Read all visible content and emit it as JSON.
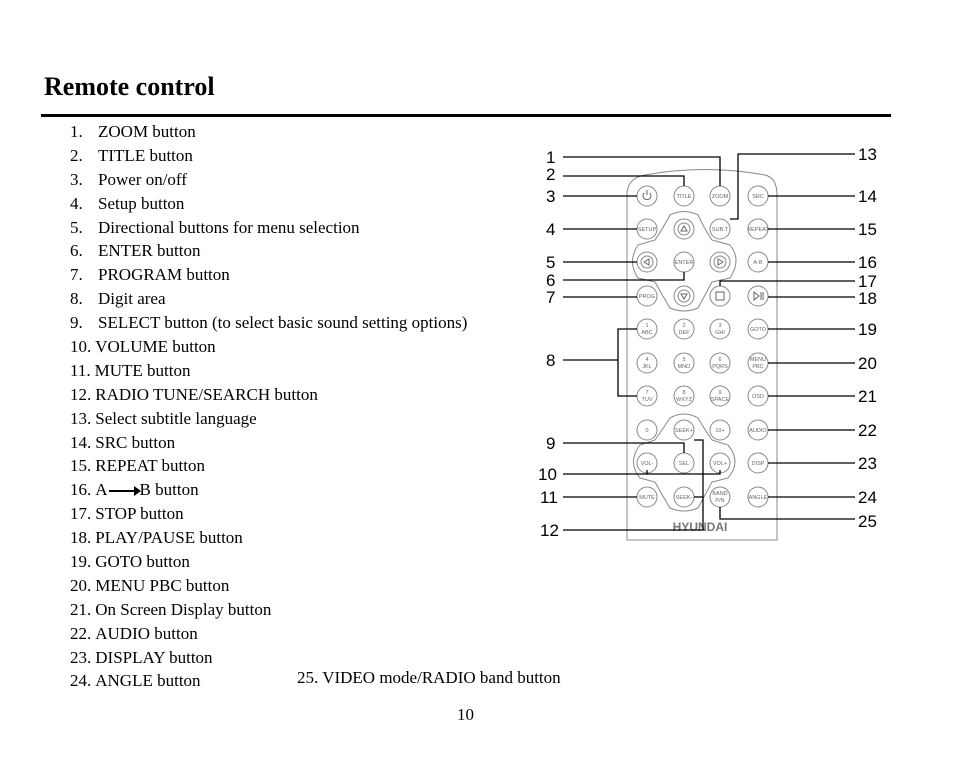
{
  "page": {
    "title": "Remote control",
    "page_number": "10"
  },
  "items": [
    {
      "num": "1.",
      "text": "ZOOM button"
    },
    {
      "num": "2.",
      "text": "TITLE button"
    },
    {
      "num": "3.",
      "text": "Power on/off"
    },
    {
      "num": "4.",
      "text": "Setup button"
    },
    {
      "num": "5.",
      "text": "Directional buttons for menu selection"
    },
    {
      "num": "6.",
      "text": "ENTER button"
    },
    {
      "num": "7.",
      "text": "PROGRAM button"
    },
    {
      "num": "8.",
      "text": "Digit area"
    },
    {
      "num": "9.",
      "text": "SELECT button (to select basic sound setting options)"
    },
    {
      "num": "10.",
      "text": "VOLUME button"
    },
    {
      "num": "11.",
      "text": "MUTE button"
    },
    {
      "num": "12.",
      "text": "RADIO TUNE/SEARCH button"
    },
    {
      "num": "13.",
      "text": "Select subtitle language"
    },
    {
      "num": "14.",
      "text": "SRC button"
    },
    {
      "num": "15.",
      "text": "REPEAT button"
    },
    {
      "num": "16.",
      "text_a": "A",
      "text_b": "B button"
    },
    {
      "num": "17.",
      "text": "STOP button"
    },
    {
      "num": "18.",
      "text": "PLAY/PAUSE button"
    },
    {
      "num": "19.",
      "text": "GOTO button"
    },
    {
      "num": "20.",
      "text": "MENU PBC button"
    },
    {
      "num": "21.",
      "text": "On Screen Display button"
    },
    {
      "num": "22.",
      "text": "AUDIO button"
    },
    {
      "num": "23.",
      "text": "DISPLAY button"
    },
    {
      "num": "24.",
      "text": "ANGLE button"
    },
    {
      "num": "25.",
      "text": "VIDEO mode/RADIO band button"
    }
  ],
  "remote": {
    "brand": "HYUNDAI",
    "callouts_left": [
      "1",
      "2",
      "3",
      "4",
      "5",
      "6",
      "7",
      "8",
      "9",
      "10",
      "11",
      "12"
    ],
    "callouts_right": [
      "13",
      "14",
      "15",
      "16",
      "17",
      "18",
      "19",
      "20",
      "21",
      "22",
      "23",
      "24",
      "25"
    ],
    "buttons": {
      "title": "TITLE",
      "zoom": "ZOOM",
      "src": "SRC",
      "setup": "SETUP",
      "subt": "SUB.T",
      "repeat": "REPEAT",
      "enter": "ENTER",
      "ab": "A-B",
      "prog": "PROG",
      "goto": "GOTO",
      "menu1": "MENU",
      "menu2": "PBC",
      "osd": "OSD",
      "audio": "AUDIO",
      "ten": "10+",
      "sel": "SEL",
      "volm": "VOL-",
      "volp": "VOL+",
      "disp": "DISP",
      "mute": "MUTE",
      "angle": "ANGLE",
      "band1": "BAND",
      "band2": "P/N",
      "seekp": "SEEK+",
      "seekm": "SEEK-",
      "d1a": "1",
      "d1b": "ABC",
      "d2a": "2",
      "d2b": "DEF",
      "d3a": "3",
      "d3b": "GHI",
      "d4a": "4",
      "d4b": "JKL",
      "d5a": "5",
      "d5b": "MNO",
      "d6a": "6",
      "d6b": "PQRS",
      "d7a": "7",
      "d7b": "TUV",
      "d8a": "8",
      "d8b": "WXYZ",
      "d9a": "9",
      "d9b": "SPACE",
      "d0": "0"
    }
  }
}
